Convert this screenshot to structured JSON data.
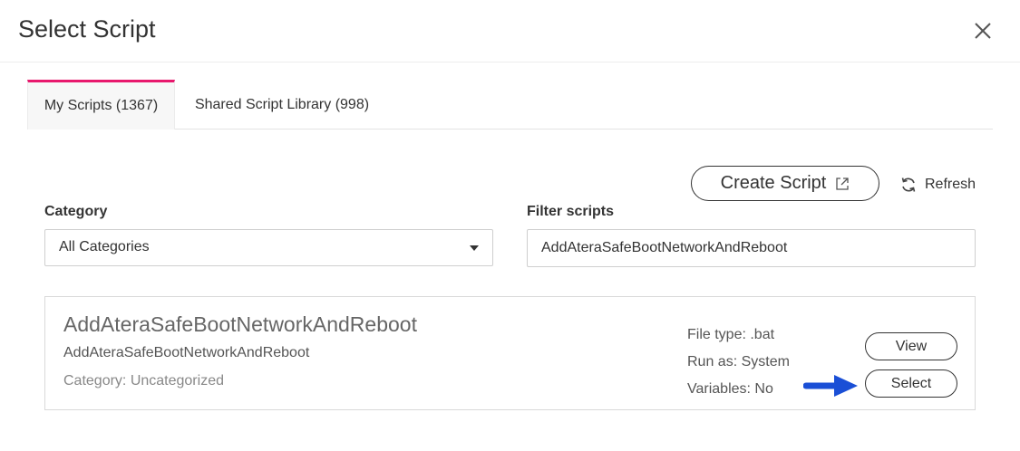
{
  "dialog": {
    "title": "Select Script"
  },
  "tabs": [
    {
      "label": "My Scripts (1367)",
      "active": true
    },
    {
      "label": "Shared Script Library (998)",
      "active": false
    }
  ],
  "toolbar": {
    "create_label": "Create Script",
    "refresh_label": "Refresh"
  },
  "filters": {
    "category_label": "Category",
    "category_value": "All Categories",
    "filter_label": "Filter scripts",
    "filter_value": "AddAteraSafeBootNetworkAndReboot"
  },
  "script": {
    "name": "AddAteraSafeBootNetworkAndReboot",
    "description": "AddAteraSafeBootNetworkAndReboot",
    "category": "Category: Uncategorized",
    "file_type": "File type: .bat",
    "run_as": "Run as: System",
    "variables": "Variables: No",
    "view_label": "View",
    "select_label": "Select"
  },
  "colors": {
    "accent": "#e8186d",
    "arrow": "#1a4fd6"
  },
  "icons": [
    "close-icon",
    "external-link-icon",
    "refresh-icon",
    "chevron-down-icon",
    "arrow-right-icon"
  ]
}
